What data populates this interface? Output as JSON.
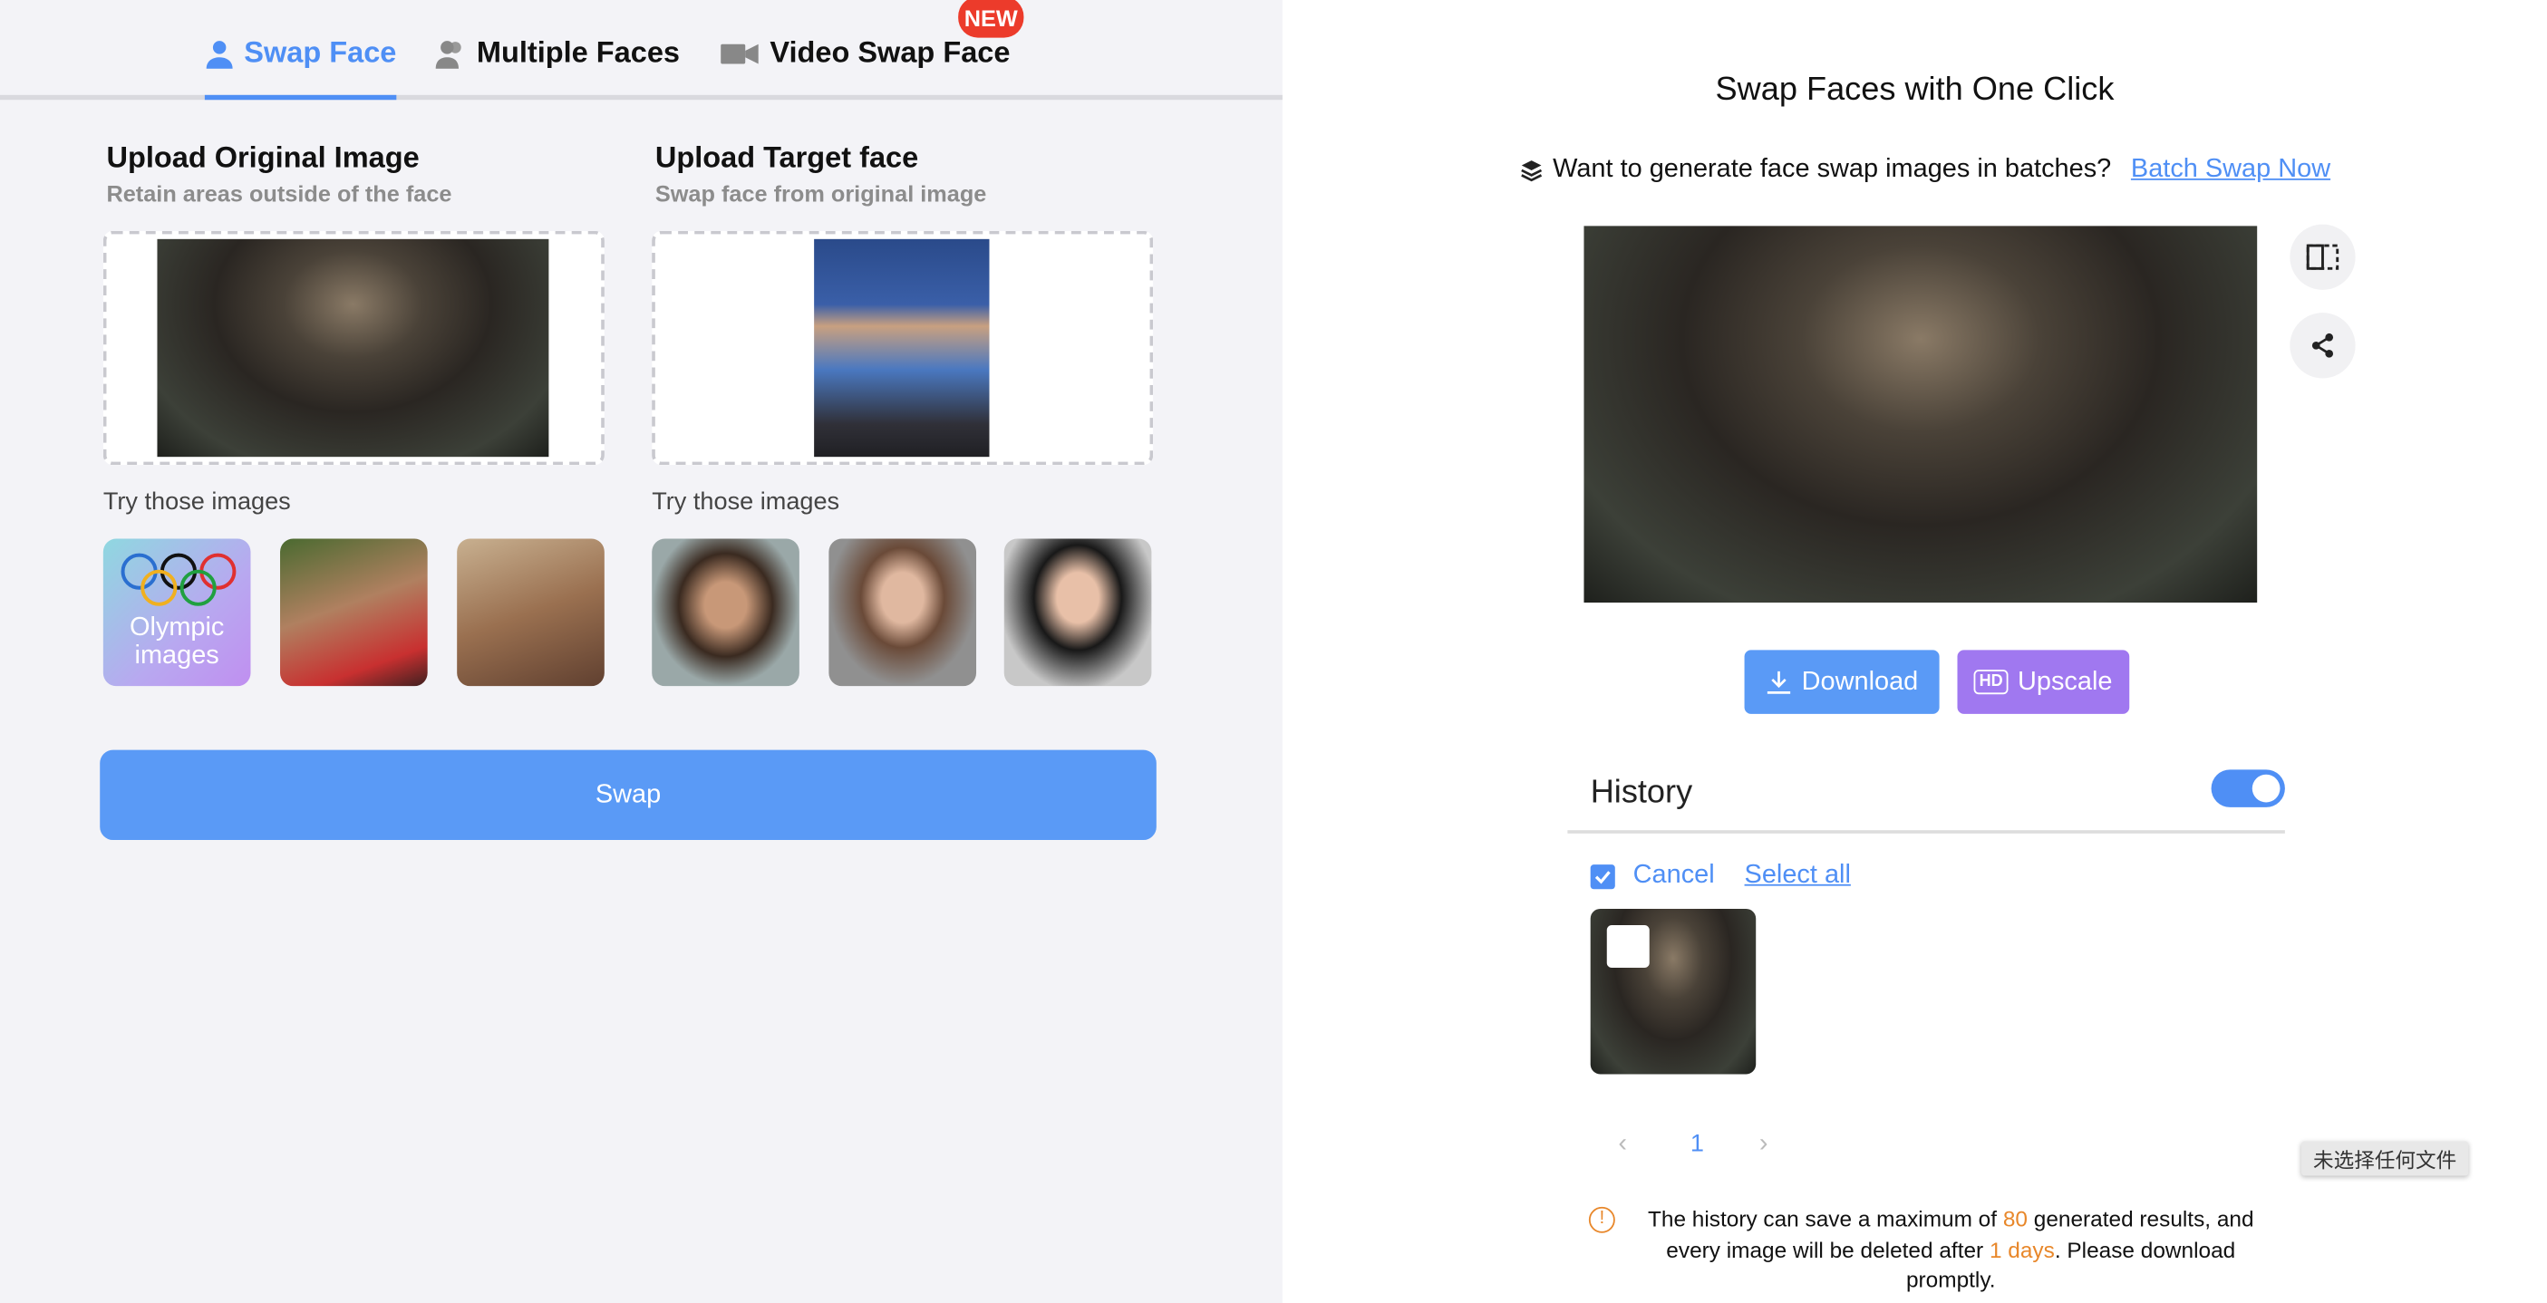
{
  "tabs": [
    {
      "label": "Swap Face",
      "icon": "person-icon",
      "active": true
    },
    {
      "label": "Multiple Faces",
      "icon": "people-icon",
      "active": false
    },
    {
      "label": "Video Swap Face",
      "icon": "video-camera-icon",
      "active": false,
      "badge": "NEW"
    }
  ],
  "original": {
    "title": "Upload Original Image",
    "subtitle": "Retain areas outside of the face",
    "try_label": "Try those images",
    "samples": [
      {
        "label": "Olympic images"
      },
      {
        "label": ""
      },
      {
        "label": ""
      }
    ]
  },
  "target": {
    "title": "Upload Target face",
    "subtitle": "Swap face from original image",
    "try_label": "Try those images"
  },
  "swap_label": "Swap",
  "result": {
    "title": "Swap Faces with One Click",
    "batch_text": "Want to generate face swap images in batches?",
    "batch_link": "Batch Swap Now",
    "download_label": "Download",
    "upscale_label": "Upscale",
    "upscale_icon_text": "HD"
  },
  "history": {
    "title": "History",
    "toggle_on": true,
    "cancel_label": "Cancel",
    "select_all_label": "Select all",
    "page": "1",
    "file_tooltip": "未选择任何文件",
    "notice": {
      "p1": "The history can save a maximum of ",
      "max": "80",
      "p2": " generated results, and every image will be deleted after ",
      "days": "1 days",
      "p3": ". Please download promptly."
    }
  },
  "colors": {
    "accent": "#4f8ff5",
    "swap_button": "#5a9af6",
    "upscale": "#a078f0",
    "badge": "#ec3b2b",
    "warning": "#e8872a"
  }
}
